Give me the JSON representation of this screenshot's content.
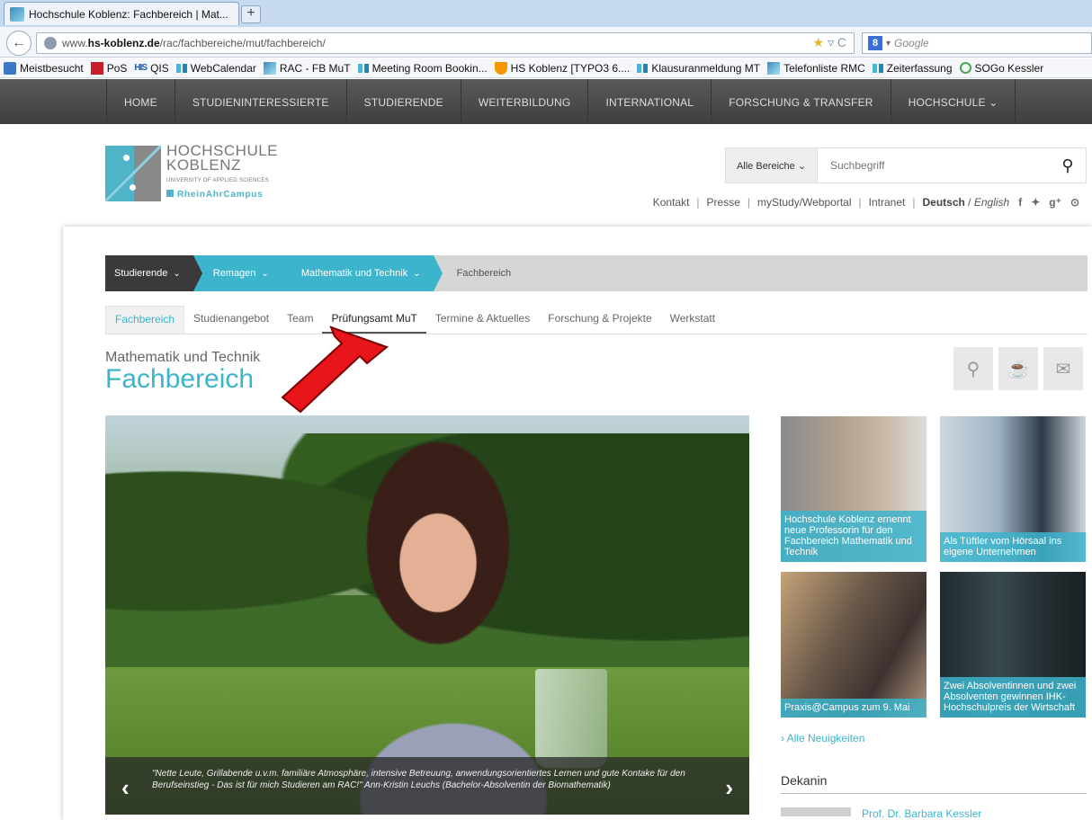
{
  "browser": {
    "tab_title": "Hochschule Koblenz: Fachbereich | Mat...",
    "new_tab": "+",
    "url_pre": "www.",
    "url_domain": "hs-koblenz.de",
    "url_path": "/rac/fachbereiche/mut/fachbereich/",
    "search_placeholder": "Google",
    "bookmarks": [
      {
        "label": "Meistbesucht",
        "icon": "blue"
      },
      {
        "label": "PoS",
        "icon": "red"
      },
      {
        "label": "QIS",
        "icon": "his"
      },
      {
        "label": "WebCalendar",
        "icon": "bar"
      },
      {
        "label": "RAC - FB MuT",
        "icon": "hs"
      },
      {
        "label": "Meeting Room Bookin...",
        "icon": "bar"
      },
      {
        "label": "HS Koblenz [TYPO3 6....",
        "icon": "t3"
      },
      {
        "label": "Klausuranmeldung MT",
        "icon": "bar"
      },
      {
        "label": "Telefonliste RMC",
        "icon": "hs"
      },
      {
        "label": "Zeiterfassung",
        "icon": "bar"
      },
      {
        "label": "SOGo Kessler",
        "icon": "so"
      }
    ]
  },
  "sitenav": [
    "HOME",
    "STUDIENINTERESSIERTE",
    "STUDIERENDE",
    "WEITERBILDUNG",
    "INTERNATIONAL",
    "FORSCHUNG & TRANSFER",
    "HOCHSCHULE ⌄"
  ],
  "logo": {
    "line1": "HOCHSCHULE",
    "line2": "KOBLENZ",
    "sub": "UNIVERSITY OF APPLIED SCIENCES",
    "campus": "RheinAhrCampus"
  },
  "search": {
    "scope": "Alle Bereiche ⌄",
    "placeholder": "Suchbegriff"
  },
  "utility": {
    "kontakt": "Kontakt",
    "presse": "Presse",
    "mystudy": "myStudy/Webportal",
    "intranet": "Intranet",
    "lang_de": "Deutsch",
    "lang_sep": " / ",
    "lang_en": "English"
  },
  "breadcrumb": [
    "Studierende",
    "Remagen",
    "Mathematik und Technik",
    "Fachbereich"
  ],
  "subtabs": [
    "Fachbereich",
    "Studienangebot",
    "Team",
    "Prüfungsamt MuT",
    "Termine & Aktuelles",
    "Forschung & Projekte",
    "Werkstatt"
  ],
  "page": {
    "kicker": "Mathematik und Technik",
    "title": "Fachbereich"
  },
  "hero_caption": "\"Nette Leute, Grillabende u.v.m. familiäre Atmosphäre, intensive Betreuung, anwendungsorientiertes Lernen und gute Kontake für den Berufseinstieg - Das ist für mich Studieren am RAC!\" Ann-Kristin Leuchs (Bachelor-Absolventin der Biomathematik)",
  "news": [
    "Hochschule Koblenz ernennt neue Professorin für den Fachbereich Mathematik und Technik",
    "Als Tüftler vom Hörsaal ins eigene Unternehmen",
    "Praxis@Campus zum 9. Mai",
    "Zwei Absolventinnen und zwei Absolventen gewinnen IHK-Hochschulpreis der Wirtschaft"
  ],
  "all_news": "› Alle Neuigkeiten",
  "dekanin": {
    "heading": "Dekanin",
    "name": "Prof. Dr. Barbara Kessler"
  },
  "colors": {
    "accent": "#3cb4cc",
    "nav": "#4d4d4d",
    "annotation": "#e8151b"
  }
}
